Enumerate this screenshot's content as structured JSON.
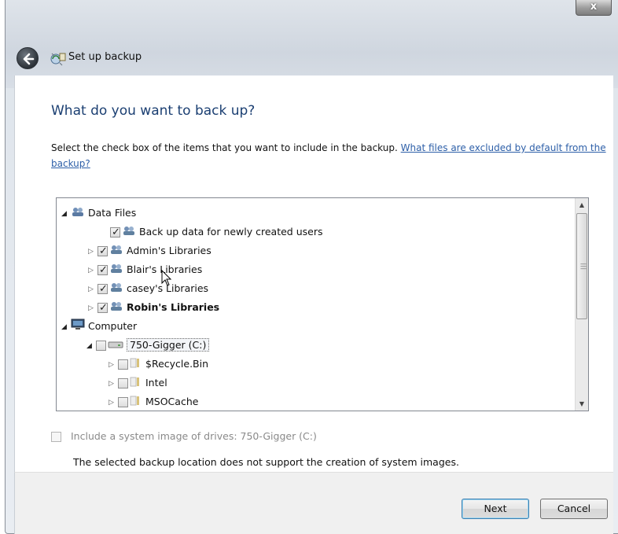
{
  "window": {
    "title": "Set up backup",
    "close_label": "x"
  },
  "page": {
    "heading": "What do you want to back up?",
    "instructions": "Select the check box of the items that you want to include in the backup.",
    "help_link": "What files are excluded by default from the backup?"
  },
  "tree": {
    "items": [
      {
        "label": "Data Files",
        "expander": "expanded",
        "checkbox": "none",
        "icon": "data-files-icon",
        "bold": false
      },
      {
        "label": "Back up data for newly created users",
        "expander": "none",
        "checkbox": "checked",
        "icon": "users-icon",
        "bold": false
      },
      {
        "label": "Admin's Libraries",
        "expander": "collapsed",
        "checkbox": "checked",
        "icon": "users-icon",
        "bold": false
      },
      {
        "label": "Blair's Libraries",
        "expander": "collapsed",
        "checkbox": "checked",
        "icon": "users-icon",
        "bold": false
      },
      {
        "label": "casey's Libraries",
        "expander": "collapsed",
        "checkbox": "checked",
        "icon": "users-icon",
        "bold": false
      },
      {
        "label": "Robin's Libraries",
        "expander": "collapsed",
        "checkbox": "checked",
        "icon": "users-icon",
        "bold": true
      },
      {
        "label": "Computer",
        "expander": "expanded",
        "checkbox": "none",
        "icon": "computer-icon",
        "bold": false
      },
      {
        "label": "750-Gigger (C:)",
        "expander": "expanded",
        "checkbox": "unchecked",
        "icon": "drive-icon",
        "bold": false
      },
      {
        "label": "$Recycle.Bin",
        "expander": "collapsed",
        "checkbox": "unchecked",
        "icon": "folder-icon",
        "bold": false
      },
      {
        "label": "Intel",
        "expander": "collapsed",
        "checkbox": "unchecked",
        "icon": "folder-icon",
        "bold": false
      },
      {
        "label": "MSOCache",
        "expander": "collapsed",
        "checkbox": "unchecked",
        "icon": "folder-icon",
        "bold": false
      }
    ]
  },
  "system_image": {
    "label": "Include a system image of drives: 750-Gigger (C:)",
    "checked": false,
    "enabled": false
  },
  "notice": "The selected backup location does not support the creation of system images.",
  "buttons": {
    "next": "Next",
    "cancel": "Cancel"
  }
}
